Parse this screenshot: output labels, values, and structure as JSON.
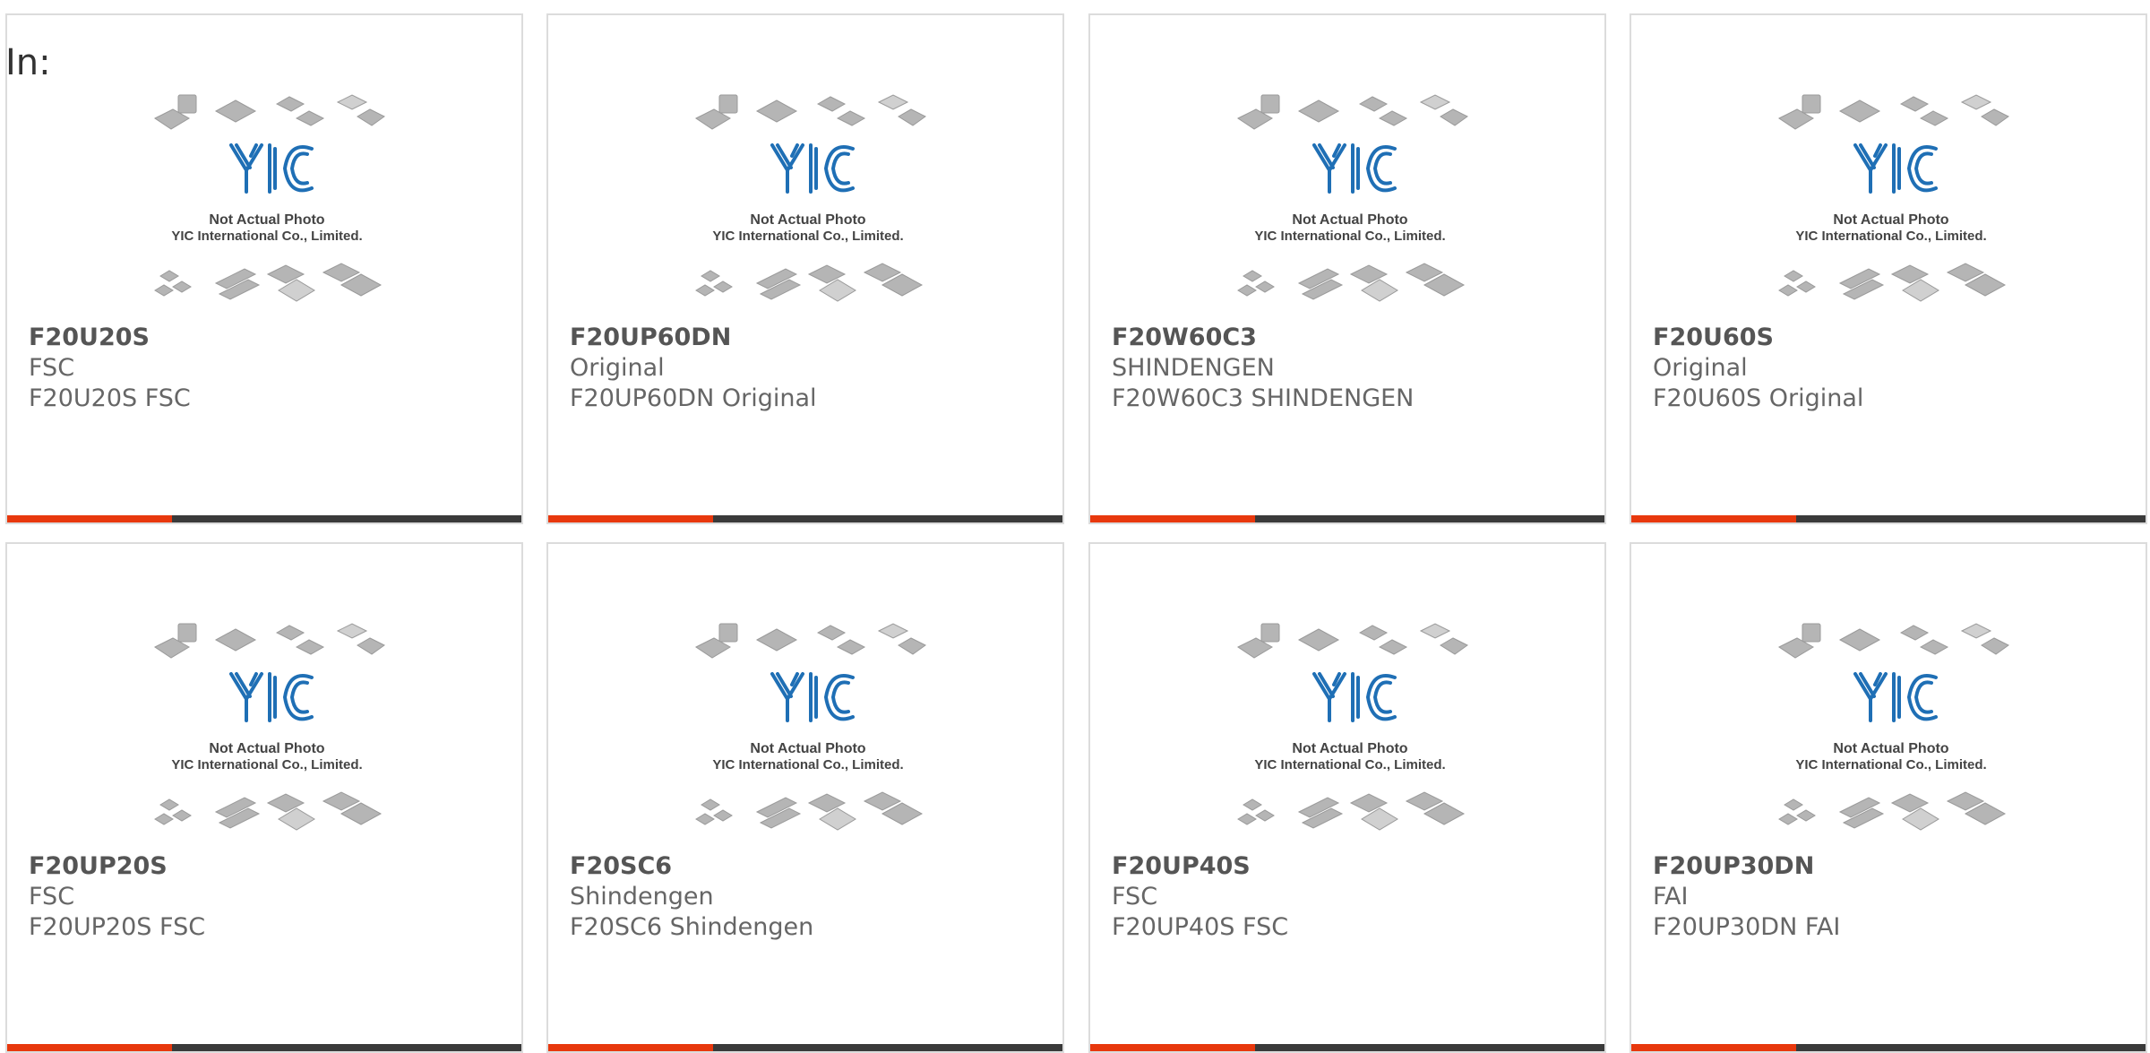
{
  "page": {
    "in_label": "In:"
  },
  "placeholder": {
    "line1": "Not Actual Photo",
    "line2": "YIC International Co., Limited.",
    "logo": "YIC"
  },
  "colors": {
    "accent": "#e8380d",
    "bar": "#3a3a3a",
    "logo_blue": "#1f6fb5"
  },
  "products": [
    {
      "part": "F20U20S",
      "mfr": "FSC",
      "desc": "F20U20S FSC"
    },
    {
      "part": "F20UP60DN",
      "mfr": "Original",
      "desc": "F20UP60DN Original"
    },
    {
      "part": "F20W60C3",
      "mfr": "SHINDENGEN",
      "desc": "F20W60C3 SHINDENGEN"
    },
    {
      "part": "F20U60S",
      "mfr": "Original",
      "desc": "F20U60S Original"
    },
    {
      "part": "F20UP20S",
      "mfr": "FSC",
      "desc": "F20UP20S FSC"
    },
    {
      "part": "F20SC6",
      "mfr": "Shindengen",
      "desc": "F20SC6 Shindengen"
    },
    {
      "part": "F20UP40S",
      "mfr": "FSC",
      "desc": "F20UP40S FSC"
    },
    {
      "part": "F20UP30DN",
      "mfr": "FAI",
      "desc": "F20UP30DN FAI"
    }
  ]
}
